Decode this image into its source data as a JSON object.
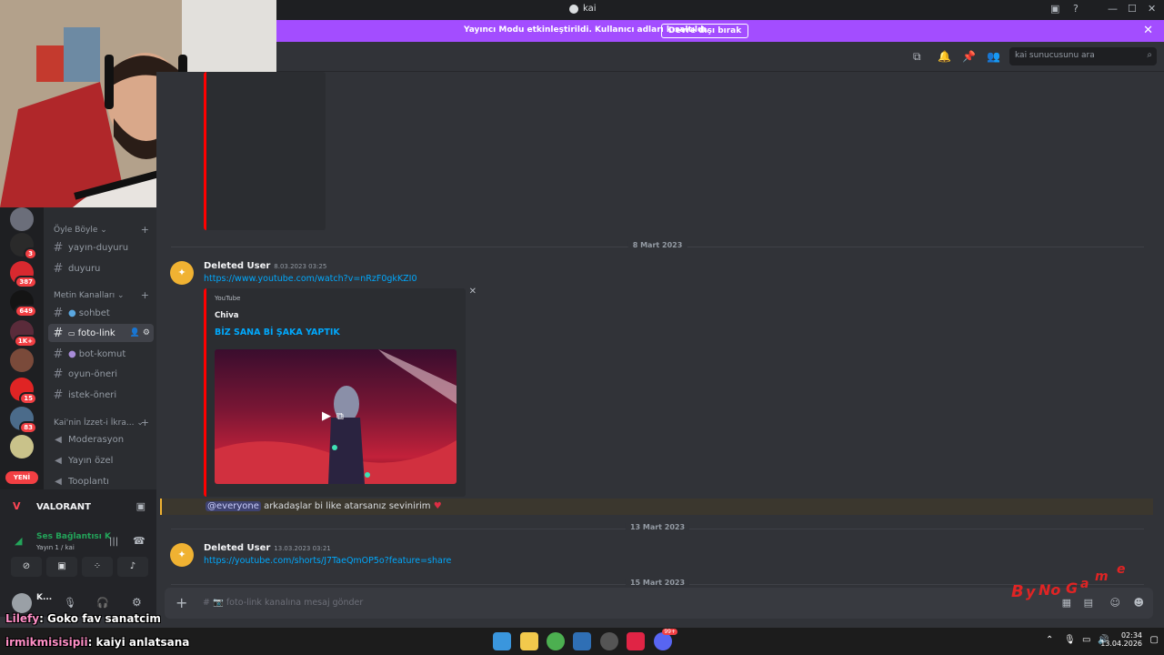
{
  "window": {
    "title": "kai"
  },
  "banner": {
    "message": "Yayıncı Modu etkinleştirildi. Kullanıcı adları kısaltıldı.",
    "button": "Devre dışı bırak"
  },
  "header": {
    "search_placeholder": "kai sunucusunu ara"
  },
  "servers": [
    {
      "badge": ""
    },
    {
      "badge": "3"
    },
    {
      "badge": "387"
    },
    {
      "badge": "649"
    },
    {
      "badge": "1K+"
    },
    {
      "badge": ""
    },
    {
      "badge": "15"
    },
    {
      "badge": "83"
    },
    {
      "badge": ""
    }
  ],
  "new_badge": "YENİ",
  "channels": {
    "cat1": "Öyle Böyle",
    "yayin_duyuru": "yayın-duyuru",
    "duyuru": "duyuru",
    "cat2": "Metin Kanalları",
    "sohbet": "sohbet",
    "foto_link": "foto-link",
    "bot_komut": "bot-komut",
    "oyun_oneri": "oyun-öneri",
    "istek_oneri": "istek-öneri",
    "cat3": "Kai'nin İzzet-i İkra...",
    "moderasyon": "Moderasyon",
    "yayin_ozel": "Yayın özel",
    "toplanti": "Tooplantı"
  },
  "user_panel": {
    "activity": "VALORANT",
    "voice_status": "Ses Bağlantısı K",
    "voice_channel": "Yayın 1 / kai",
    "username": "K..."
  },
  "chat": {
    "divider1": "8 Mart 2023",
    "msg1": {
      "author": "Deleted User",
      "timestamp": "8.03.2023 03:25",
      "link": "https://www.youtube.com/watch?v=nRzF0gkKZI0"
    },
    "embed": {
      "provider": "YouTube",
      "author": "Chiva",
      "title": "BİZ SANA Bİ ŞAKA YAPTIK"
    },
    "msg_everyone": {
      "mention": "@everyone",
      "text": "arkadaşlar bi like atarsanız sevinirim"
    },
    "divider2": "13 Mart 2023",
    "msg2": {
      "author": "Deleted User",
      "timestamp": "13.03.2023 03:21",
      "link": "https://youtube.com/shorts/J7TaeQmOP5o?feature=share"
    },
    "divider3": "15 Mart 2023"
  },
  "composer": {
    "placeholder": "# 📷 foto-link kanalına mesaj gönder"
  },
  "overlay_chat": [
    {
      "user": "Lilefy",
      "text": ": Goko fav sanatcim"
    },
    {
      "user": "irmikmisisipii",
      "text": ": kaiyi anlatsana"
    }
  ],
  "taskbar": {
    "time": "02:34",
    "date": "13.04.2026",
    "discord_badge": "99+"
  },
  "colors": {
    "banner": "#a34dff",
    "link": "#00a8fc",
    "embed_border": "#ff0000",
    "mention_bg": "#3b372e"
  }
}
